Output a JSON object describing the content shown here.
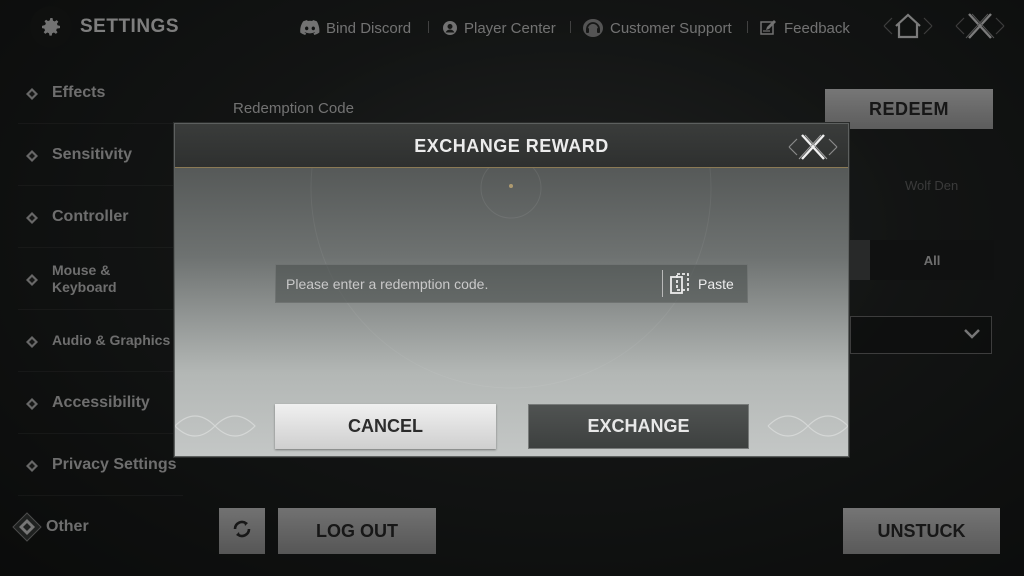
{
  "header": {
    "title": "SETTINGS",
    "links": [
      {
        "label": "Bind Discord",
        "icon": "discord-icon"
      },
      {
        "label": "Player Center",
        "icon": "player-icon"
      },
      {
        "label": "Customer Support",
        "icon": "headset-icon"
      },
      {
        "label": "Feedback",
        "icon": "edit-icon"
      }
    ],
    "home_icon": "home-icon",
    "close_icon": "close-icon"
  },
  "sidebar": {
    "items": [
      {
        "label": "Effects"
      },
      {
        "label": "Sensitivity"
      },
      {
        "label": "Controller"
      },
      {
        "label_line1": "Mouse &",
        "label_line2": "Keyboard"
      },
      {
        "label": "Audio & Graphics"
      },
      {
        "label": "Accessibility"
      },
      {
        "label": "Privacy Settings"
      },
      {
        "label": "Other",
        "active": true
      }
    ]
  },
  "content": {
    "redemption_label": "Redemption Code",
    "redeem_button": "REDEEM",
    "wolf_den": "Wolf Den",
    "all_tab": "All",
    "logout_button": "LOG OUT",
    "unstuck_button": "UNSTUCK"
  },
  "modal": {
    "title": "EXCHANGE REWARD",
    "code_placeholder": "Please enter a redemption code.",
    "code_value": "",
    "paste_label": "Paste",
    "cancel_button": "CANCEL",
    "exchange_button": "EXCHANGE"
  },
  "colors": {
    "accent_gold": "#8b7a55",
    "button_light": "#d8d8d8",
    "button_dark": "#444746"
  }
}
